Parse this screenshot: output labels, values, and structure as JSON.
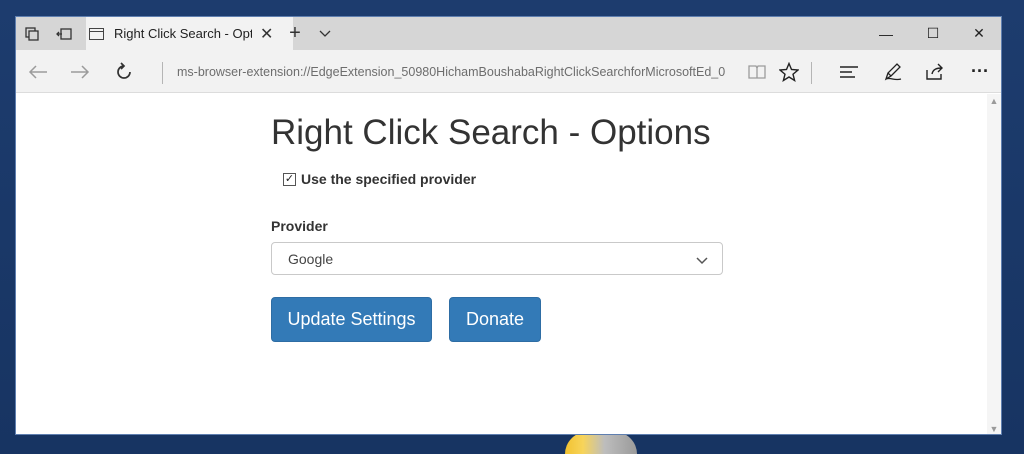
{
  "browser": {
    "tab": {
      "title": "Right Click Search - Opt",
      "close": "✕"
    },
    "new_tab": "+",
    "address": "ms-browser-extension://EdgeExtension_50980HichamBoushabaRightClickSearchforMicrosoftEd_0",
    "window_controls": {
      "minimize": "—",
      "maximize": "☐",
      "close": "✕"
    },
    "toolbar": {
      "more": "···"
    }
  },
  "page": {
    "title": "Right Click Search - Options",
    "use_provider": {
      "label": "Use the specified provider",
      "checked": true
    },
    "provider_label": "Provider",
    "provider_value": "Google",
    "buttons": {
      "update": "Update Settings",
      "donate": "Donate"
    }
  },
  "colors": {
    "button_primary": "#337ab7",
    "desktop_background": "#1c3a6b"
  }
}
